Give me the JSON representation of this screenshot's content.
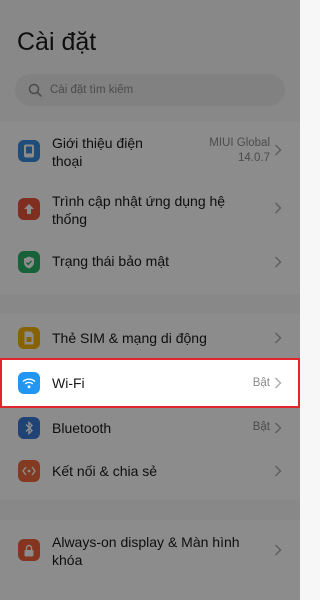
{
  "header": {
    "title": "Cài đặt"
  },
  "search": {
    "placeholder": "Cài đặt tìm kiếm"
  },
  "rows": [
    {
      "label_line1": "Giới thiệu điện",
      "label_line2": "thoại",
      "value_line1": "MIUI Global",
      "value_line2": "14.0.7",
      "icon": "phone-info-icon",
      "icon_color": "#3a8dde"
    },
    {
      "label_line1": "Trình cập nhật ứng dụng hệ",
      "label_line2": "thống",
      "icon": "update-arrow-icon",
      "icon_color": "#e8553a"
    },
    {
      "label": "Trạng thái bảo mật",
      "icon": "shield-check-icon",
      "icon_color": "#2cb36a"
    },
    {
      "label": "Thẻ SIM & mạng di động",
      "icon": "sim-card-icon",
      "icon_color": "#f4b400"
    },
    {
      "label": "Wi-Fi",
      "value": "Bật",
      "icon": "wifi-icon",
      "icon_color": "#2196f3"
    },
    {
      "label": "Bluetooth",
      "value": "Bật",
      "icon": "bluetooth-icon",
      "icon_color": "#3a7bd5"
    },
    {
      "label": "Kết nối & chia sẻ",
      "icon": "connection-share-icon",
      "icon_color": "#ee6b3b"
    },
    {
      "label_line1": "Always-on display & Màn hình",
      "label_line2": "khóa",
      "icon": "lock-icon",
      "icon_color": "#f0603a"
    }
  ],
  "colors": {
    "highlight": "#e0262b",
    "overlay": "rgba(0,0,0,0.45)"
  }
}
